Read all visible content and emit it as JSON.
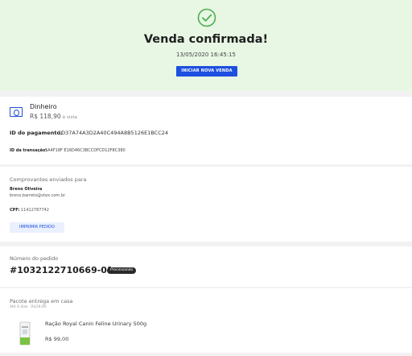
{
  "header": {
    "title": "Venda confirmada!",
    "datetime": "13/05/2020 16:45:15",
    "new_sale_button": "INICIAR NOVA VENDA",
    "success_color": "#4caf50"
  },
  "payment": {
    "icon": "cash-icon",
    "method": "Dinheiro",
    "amount": "R$ 118,90",
    "amount_note": "à vista",
    "payment_id_label": "ID do pagamento:",
    "payment_id": "1D37A74A3D2A40C494A8B5126E1BCC24",
    "transaction_id_label": "ID da transação:",
    "transaction_id": "5A4F18F E16D46C3BCCDFCD12F8C380"
  },
  "receipts": {
    "title": "Comprovantes enviados para",
    "name": "Breno Oliveira",
    "email": "breno.barreto@vtex.com.br",
    "cpf_label": "CPF:",
    "cpf": "11412787742",
    "print_button": "IMPRIMIR PEDIDO"
  },
  "order": {
    "label": "Número do pedido",
    "number": "#1032122710669-01",
    "status": "Processando"
  },
  "package": {
    "title": "Pacote entrega em casa",
    "subtitle": "Até 4 dias · R$19,90",
    "product_name": "Ração Royal Canin Feline Urinary 500g",
    "product_price": "R$ 99,00"
  },
  "colors": {
    "header_bg": "#e8f7e4",
    "accent": "#1d4fe0"
  }
}
